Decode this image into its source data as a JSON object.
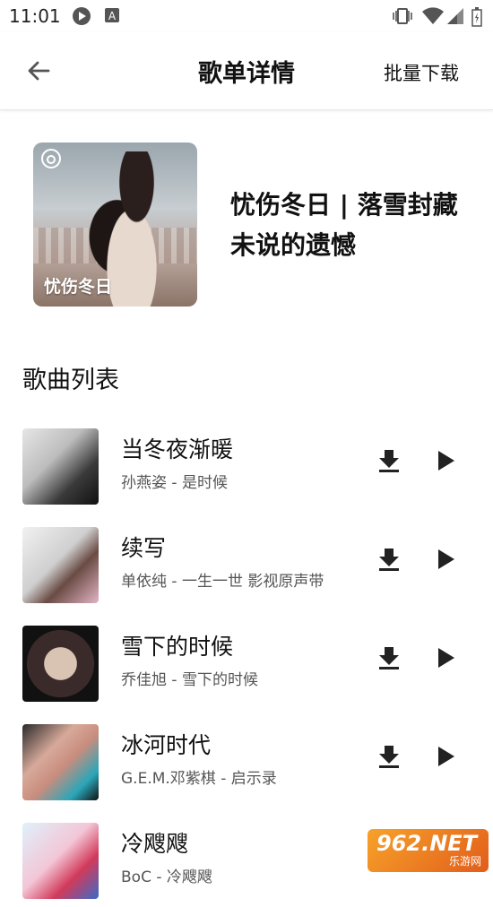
{
  "status": {
    "time": "11:01"
  },
  "header": {
    "title": "歌单详情",
    "batch_download": "批量下载"
  },
  "playlist": {
    "cover_text": "忧伤冬日",
    "title": "忧伤冬日 | 落雪封藏未说的遗憾"
  },
  "section": {
    "title": "歌曲列表"
  },
  "songs": [
    {
      "name": "当冬夜渐暖",
      "sub": "孙燕姿 - 是时候"
    },
    {
      "name": "续写",
      "sub": "单依纯 - 一生一世 影视原声带"
    },
    {
      "name": "雪下的时候",
      "sub": "乔佳旭 - 雪下的时候"
    },
    {
      "name": "冰河时代",
      "sub": "G.E.M.邓紫棋 - 启示录"
    },
    {
      "name": "冷飕飕",
      "sub": "BoC - 冷飕飕"
    }
  ],
  "watermark": {
    "brand": "962.NET",
    "sub": "乐游网"
  },
  "colors": {
    "accent": "#111111",
    "watermark": "#f08a24"
  }
}
